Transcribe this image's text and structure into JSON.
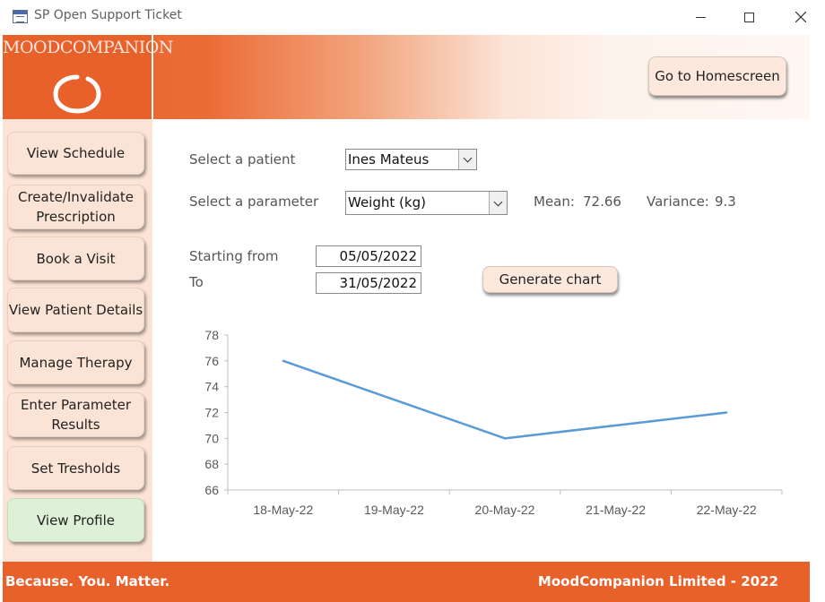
{
  "window": {
    "title": "SP Open Support Ticket",
    "icons": [
      "form-icon",
      "minimize-icon",
      "maximize-icon",
      "close-icon"
    ]
  },
  "header": {
    "logo_text": "MOODCOMPANION",
    "home_button": "Go to Homescreen",
    "brand_color": "#E8612A"
  },
  "sidebar": {
    "items": [
      {
        "label": "View Schedule"
      },
      {
        "label": "Create/Invalidate Prescription"
      },
      {
        "label": "Book a Visit"
      },
      {
        "label": "View Patient Details"
      },
      {
        "label": "Manage Therapy"
      },
      {
        "label": "Enter Parameter Results"
      },
      {
        "label": "Set Tresholds"
      },
      {
        "label": "View Profile",
        "active": true
      }
    ]
  },
  "form": {
    "patient_label": "Select a patient",
    "patient_value": "Ines Mateus",
    "parameter_label": "Select a parameter",
    "parameter_value": "Weight (kg)",
    "mean_label": "Mean:",
    "mean_value": "72.66",
    "variance_label": "Variance:",
    "variance_value": "9.3",
    "start_label": "Starting from",
    "start_value": "05/05/2022",
    "end_label": "To",
    "end_value": "31/05/2022",
    "generate_button": "Generate chart"
  },
  "chart_data": {
    "type": "line",
    "categories": [
      "18-May-22",
      "19-May-22",
      "20-May-22",
      "21-May-22",
      "22-May-22"
    ],
    "series": [
      {
        "points": [
          {
            "x": "18-May-22",
            "y": 76
          },
          {
            "x": "20-May-22",
            "y": 70
          },
          {
            "x": "22-May-22",
            "y": 72
          }
        ]
      }
    ],
    "ylim": [
      66,
      78
    ],
    "yticks": [
      66,
      68,
      70,
      72,
      74,
      76,
      78
    ],
    "grid": false,
    "line_color": "#5B9BD5"
  },
  "footer": {
    "left": "Because. You. Matter.",
    "right": "MoodCompanion Limited - 2022"
  }
}
